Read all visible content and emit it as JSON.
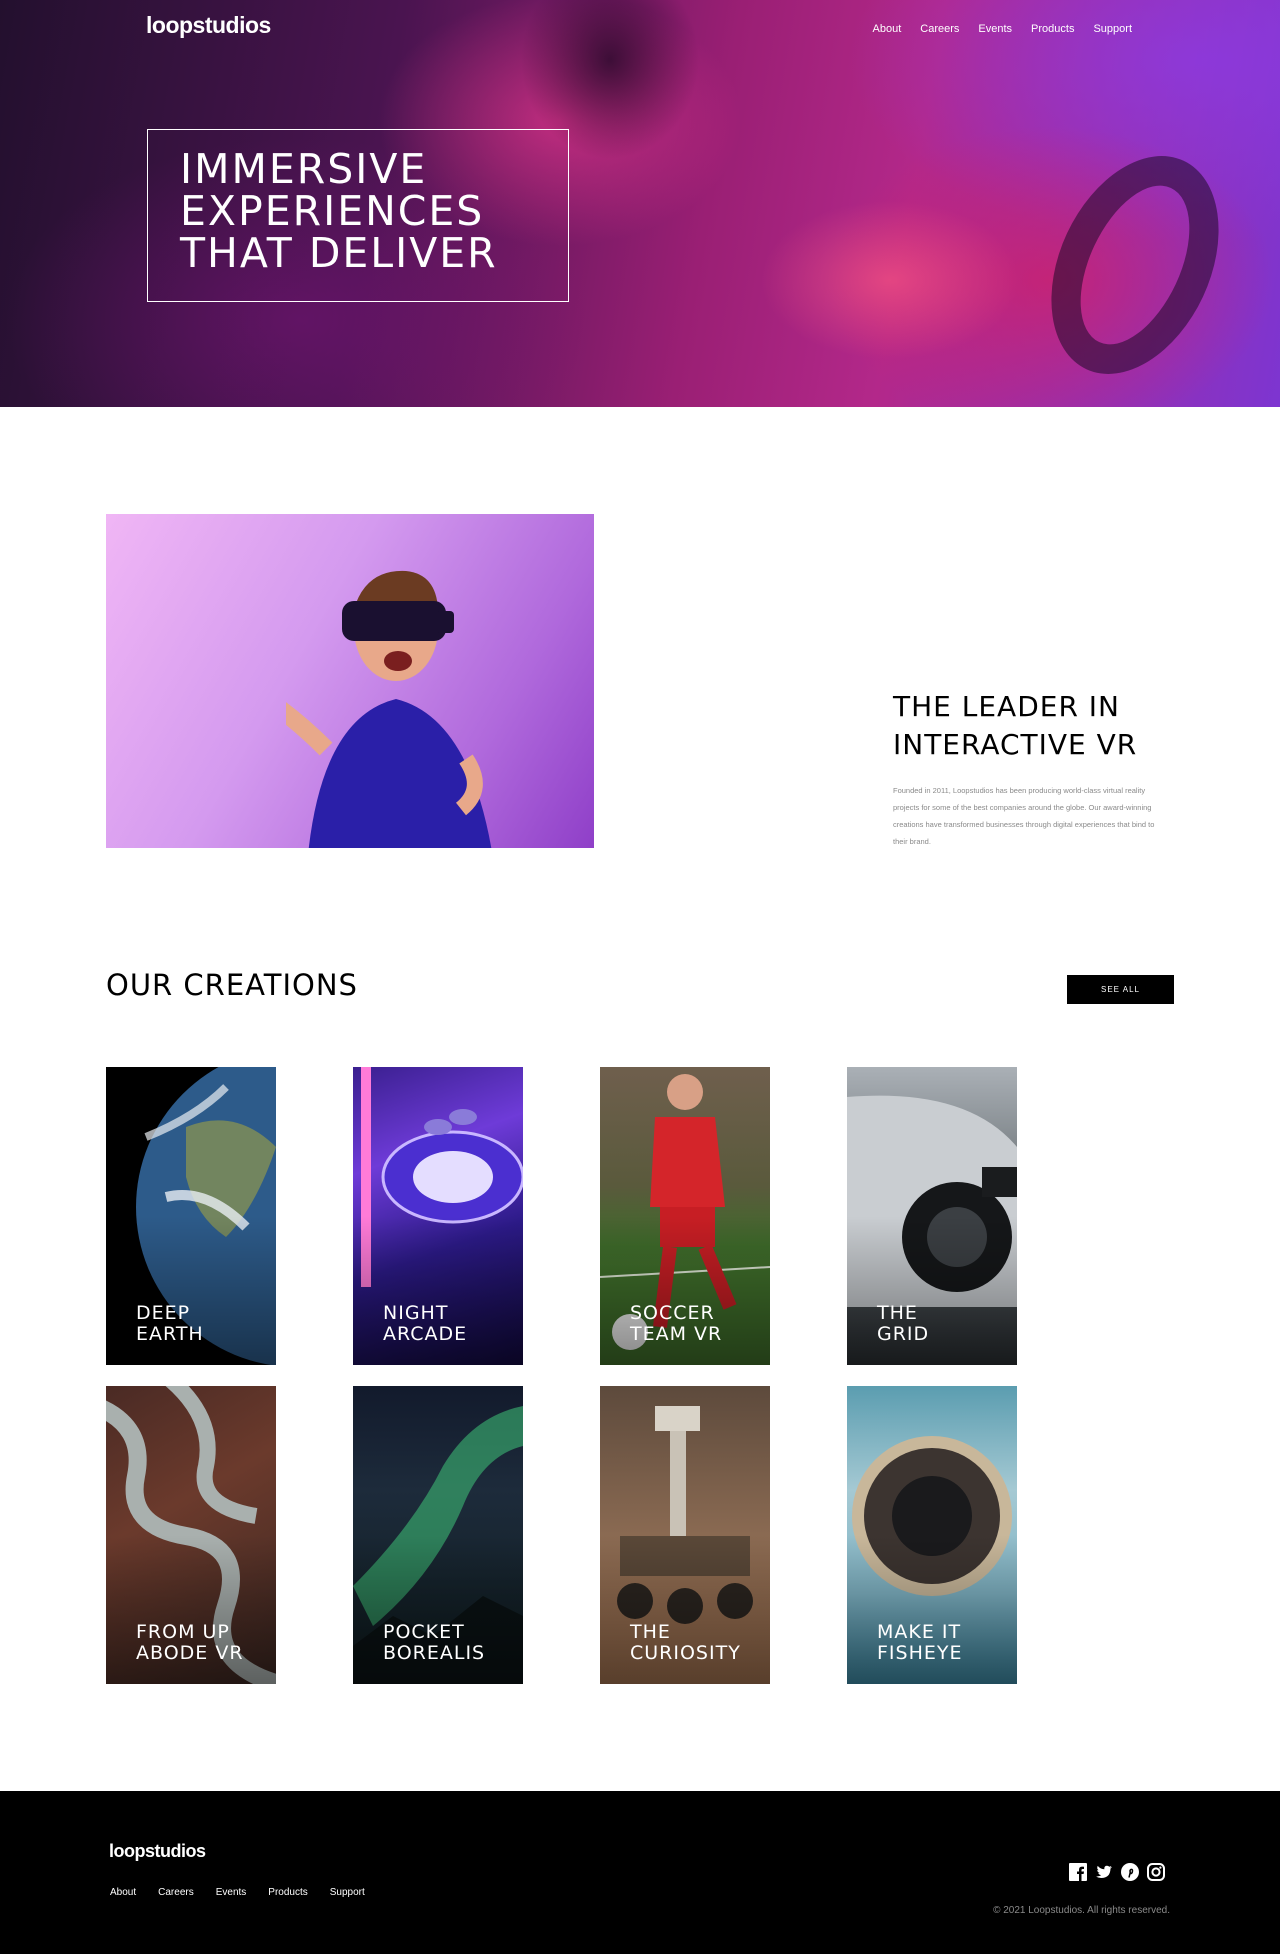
{
  "header": {
    "logo": "loopstudios",
    "nav": [
      "About",
      "Careers",
      "Events",
      "Products",
      "Support"
    ]
  },
  "hero": {
    "headline": "IMMERSIVE EXPERIENCES THAT DELIVER"
  },
  "about": {
    "title": "THE LEADER IN INTERACTIVE VR",
    "body": "Founded in 2011, Loopstudios has been producing world-class virtual reality projects for some of the best companies around the globe. Our award-winning creations have transformed businesses through digital experiences that bind to their brand."
  },
  "creations": {
    "title": "OUR CREATIONS",
    "see_all": "SEE ALL",
    "items": [
      {
        "label": "DEEP\nEARTH"
      },
      {
        "label": "NIGHT\nARCADE"
      },
      {
        "label": "SOCCER\nTEAM VR"
      },
      {
        "label": "THE\nGRID"
      },
      {
        "label": "FROM UP\nABODE VR"
      },
      {
        "label": "POCKET\nBOREALIS"
      },
      {
        "label": "THE\nCURIOSITY"
      },
      {
        "label": "MAKE IT\nFISHEYE"
      }
    ]
  },
  "footer": {
    "logo": "loopstudios",
    "nav": [
      "About",
      "Careers",
      "Events",
      "Products",
      "Support"
    ],
    "social": [
      "facebook-icon",
      "twitter-icon",
      "pinterest-icon",
      "instagram-icon"
    ],
    "copyright": "© 2021 Loopstudios. All rights reserved."
  }
}
